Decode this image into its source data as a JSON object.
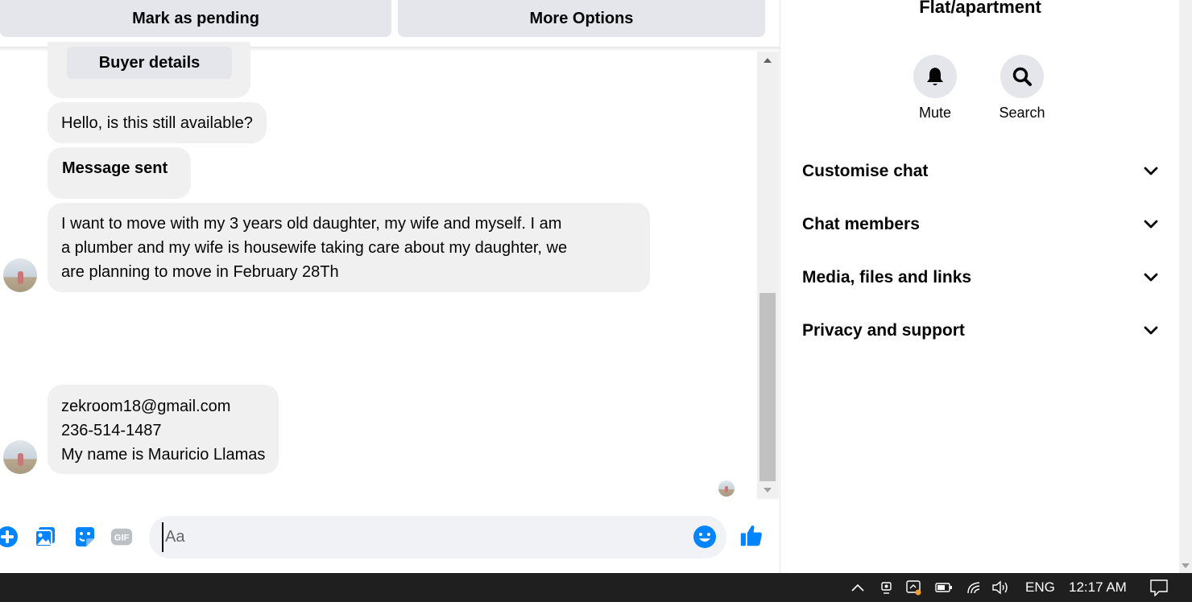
{
  "toolbar": {
    "mark_pending_label": "Mark as pending",
    "more_options_label": "More Options"
  },
  "chat": {
    "buyer_details_label": "Buyer details",
    "messages": [
      {
        "text": "Hello, is this still available?"
      },
      {
        "text": "Message sent"
      },
      {
        "lines": [
          "I want to move with my 3 years old daughter, my wife and myself. I am",
          "a plumber and my wife is housewife taking care about my daughter, we",
          "are planning to move in February 28Th"
        ]
      },
      {
        "lines": [
          "zekroom18@gmail.com",
          "236-514-1487",
          "My name is Mauricio Llamas"
        ]
      }
    ]
  },
  "composer": {
    "placeholder": "Aa",
    "gif_label": "GIF",
    "icons": [
      "plus-circle-icon",
      "photo-icon",
      "sticker-icon",
      "gif-icon",
      "emoji-icon",
      "thumbs-up-icon"
    ]
  },
  "panel": {
    "title": "Flat/apartment",
    "mute_label": "Mute",
    "search_label": "Search",
    "sections": [
      {
        "label": "Customise chat"
      },
      {
        "label": "Chat members"
      },
      {
        "label": "Media, files and links"
      },
      {
        "label": "Privacy and support"
      }
    ]
  },
  "taskbar": {
    "language": "ENG",
    "time": "12:17 AM"
  },
  "colors": {
    "accent": "#0084ff",
    "bubble": "#f0f0f0",
    "button": "#e4e6eb",
    "taskbar": "#1f1f1f"
  }
}
